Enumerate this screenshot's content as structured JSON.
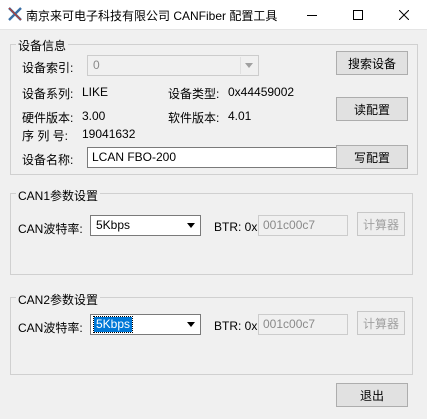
{
  "window": {
    "title": "南京来可电子科技有限公司 CANFiber 配置工具",
    "controls": {
      "minimize": "minimize-icon",
      "maximize": "maximize-icon",
      "close": "close-icon"
    }
  },
  "device_info": {
    "legend": "设备信息",
    "index_label": "设备索引:",
    "index_value": "0",
    "series_label": "设备系列:",
    "series_value": "LIKE",
    "type_label": "设备类型:",
    "type_value": "0x44459002",
    "hw_label": "硬件版本:",
    "hw_value": "3.00",
    "sw_label": "软件版本:",
    "sw_value": "4.01",
    "serial_label": "序 列 号:",
    "serial_value": "19041632",
    "name_label": "设备名称:",
    "name_value": "LCAN FBO-200",
    "search_button": "搜索设备",
    "read_button": "读配置",
    "write_button": "写配置"
  },
  "can1": {
    "legend": "CAN1参数设置",
    "baud_label": "CAN波特率:",
    "baud_value": "5Kbps",
    "btr_label": "BTR: 0x",
    "btr_value": "001c00c7",
    "calc_button": "计算器"
  },
  "can2": {
    "legend": "CAN2参数设置",
    "baud_label": "CAN波特率:",
    "baud_value": "5Kbps",
    "btr_label": "BTR: 0x",
    "btr_value": "001c00c7",
    "calc_button": "计算器"
  },
  "exit_button": "退出"
}
